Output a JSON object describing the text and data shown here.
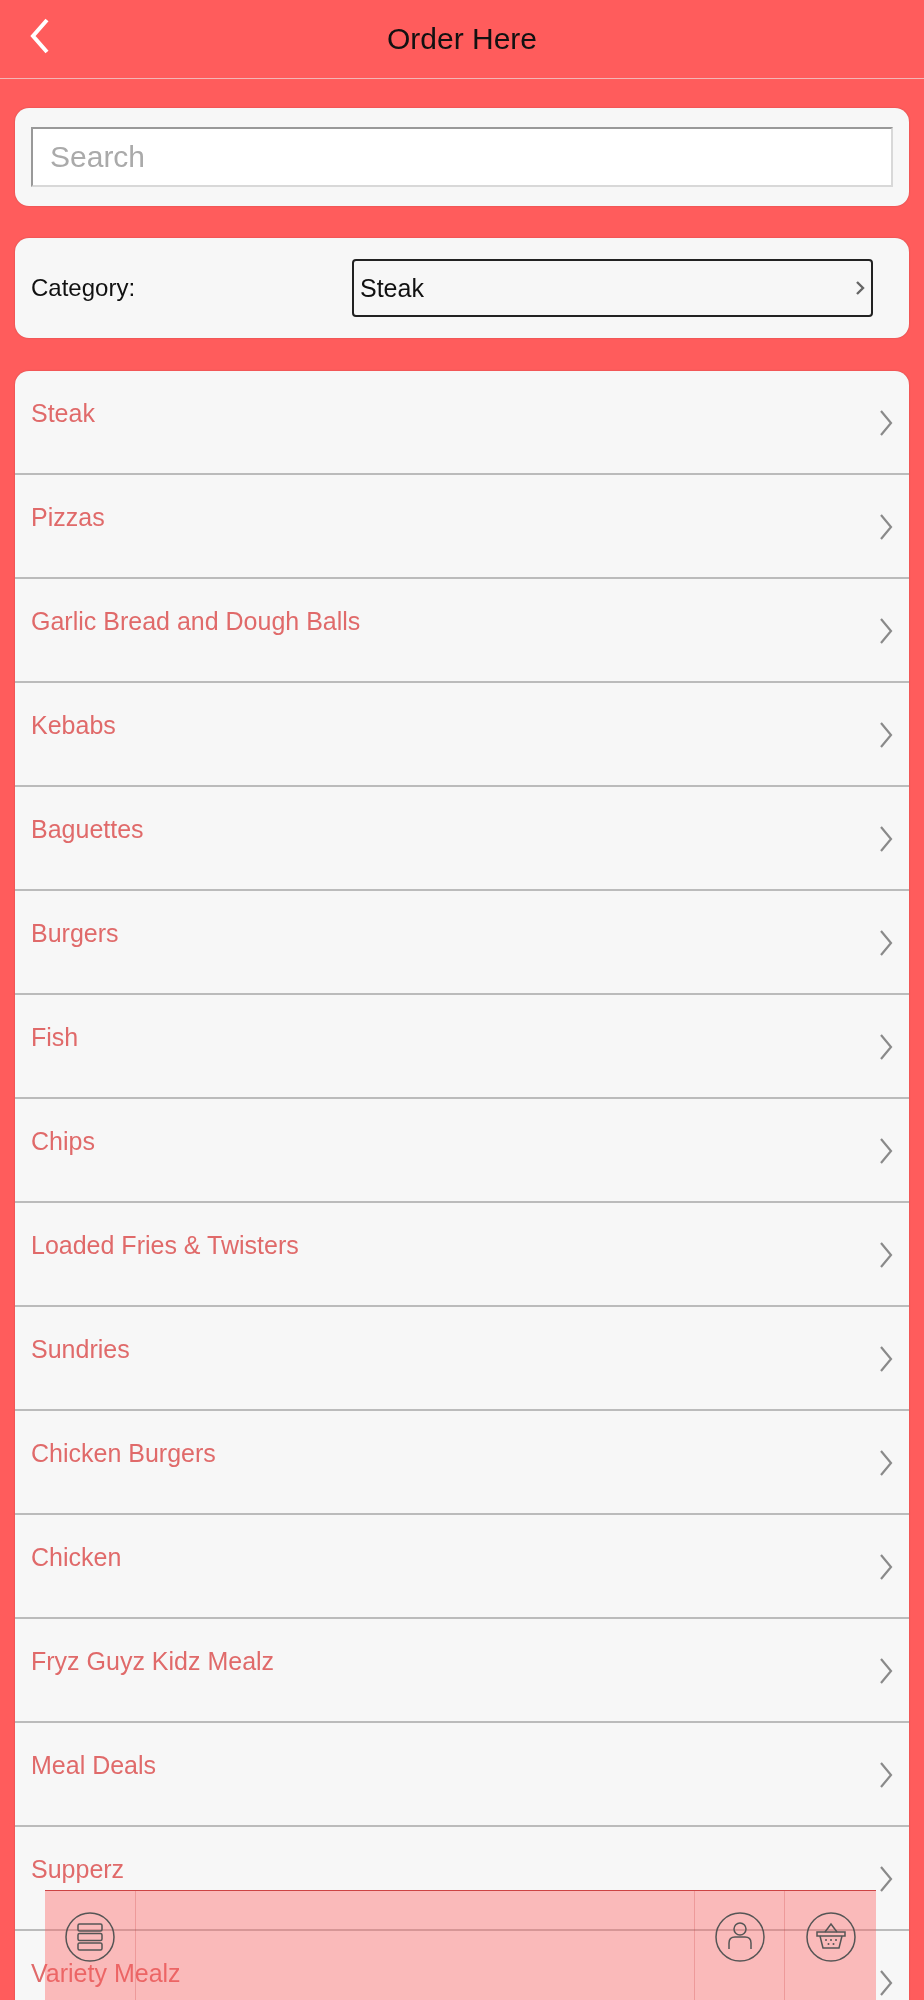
{
  "header": {
    "title": "Order Here"
  },
  "search": {
    "placeholder": "Search"
  },
  "category": {
    "label": "Category:",
    "value": "Steak"
  },
  "items": [
    {
      "label": "Steak"
    },
    {
      "label": "Pizzas"
    },
    {
      "label": "Garlic Bread and Dough Balls"
    },
    {
      "label": "Kebabs"
    },
    {
      "label": "Baguettes"
    },
    {
      "label": "Burgers"
    },
    {
      "label": "Fish"
    },
    {
      "label": "Chips"
    },
    {
      "label": "Loaded Fries & Twisters"
    },
    {
      "label": "Sundries"
    },
    {
      "label": "Chicken Burgers"
    },
    {
      "label": "Chicken"
    },
    {
      "label": "Fryz Guyz Kidz Mealz"
    },
    {
      "label": "Meal Deals"
    },
    {
      "label": "Supperz"
    },
    {
      "label": "Variety Mealz"
    }
  ],
  "bottom_bar": {
    "buttons": [
      {
        "kind": "menu"
      },
      {
        "kind": "spacer"
      },
      {
        "kind": "account"
      },
      {
        "kind": "basket"
      }
    ]
  }
}
